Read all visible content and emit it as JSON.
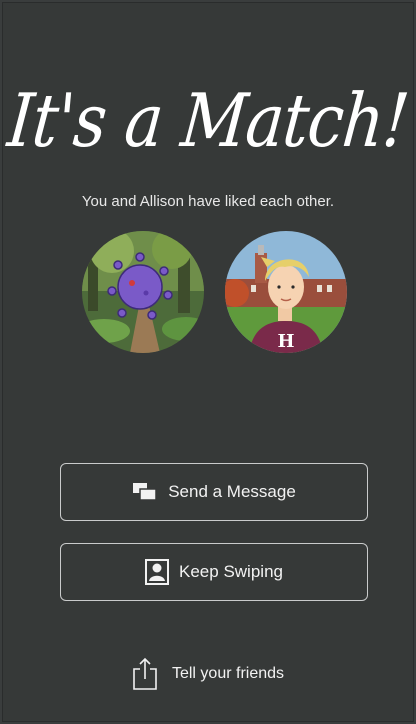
{
  "match": {
    "title": "It's a Match!",
    "subtitle": "You and Allison have liked each other."
  },
  "actions": {
    "send_message_label": "Send a Message",
    "keep_swiping_label": "Keep Swiping",
    "share_label": "Tell your friends"
  },
  "icons": {
    "send_message": "chat-bubbles-icon",
    "keep_swiping": "person-portrait-icon",
    "share": "share-icon"
  },
  "colors": {
    "background": "#363938",
    "text": "#ffffff",
    "button_border": "#c9cbcb"
  }
}
